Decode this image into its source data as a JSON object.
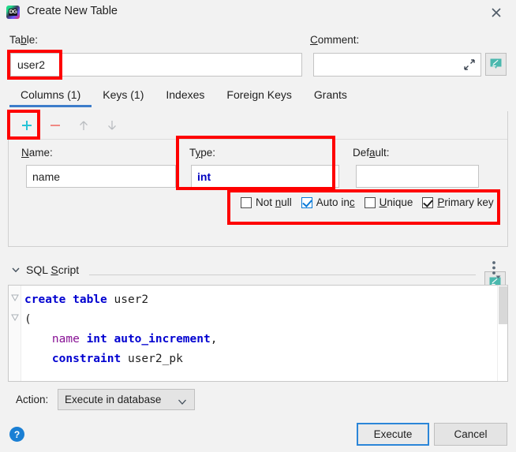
{
  "window": {
    "title": "Create New Table",
    "app_icon": "datagrip-icon",
    "close_icon": "close-icon"
  },
  "form": {
    "table_label": "Table:",
    "table_label_mnemonic": "b",
    "table_value": "user2",
    "comment_label": "Comment:",
    "comment_label_mnemonic": "C",
    "comment_value": "",
    "comment_expand_icon": "expand-icon",
    "comment_edit_icon": "edit-comment-icon"
  },
  "tabs": [
    {
      "label": "Columns (1)",
      "active": true
    },
    {
      "label": "Keys (1)",
      "active": false
    },
    {
      "label": "Indexes",
      "active": false
    },
    {
      "label": "Foreign Keys",
      "active": false
    },
    {
      "label": "Grants",
      "active": false
    }
  ],
  "toolbar": {
    "add_icon": "plus-icon",
    "remove_icon": "minus-icon",
    "move_up_icon": "arrow-up-icon",
    "move_down_icon": "arrow-down-icon"
  },
  "column_editor": {
    "name_label": "Name:",
    "name_label_mnemonic": "N",
    "name_value": "name",
    "type_label": "Type:",
    "type_label_mnemonic": "y",
    "type_value": "int",
    "default_label": "Default:",
    "default_label_mnemonic": "a",
    "default_value": "",
    "default_edit_icon": "edit-default-icon",
    "checkboxes": [
      {
        "label": "Not null",
        "mnemonic": "n",
        "checked": false,
        "accent": "default"
      },
      {
        "label": "Auto inc",
        "mnemonic": "c",
        "checked": true,
        "accent": "blue"
      },
      {
        "label": "Unique",
        "mnemonic": "U",
        "checked": false,
        "accent": "default"
      },
      {
        "label": "Primary key",
        "mnemonic": "P",
        "checked": true,
        "accent": "default"
      }
    ]
  },
  "sql_script": {
    "section_title": "SQL Script",
    "section_title_mnemonic": "S",
    "collapse_icon": "chevron-down-icon",
    "options_icon": "more-options-icon",
    "lines": [
      [
        {
          "t": "create table ",
          "c": "kw"
        },
        {
          "t": "user2",
          "c": "id"
        }
      ],
      [
        {
          "t": "(",
          "c": "id"
        }
      ],
      [
        {
          "t": "    ",
          "c": "id"
        },
        {
          "t": "name",
          "c": "col"
        },
        {
          "t": " ",
          "c": "id"
        },
        {
          "t": "int auto_increment",
          "c": "kw"
        },
        {
          "t": ",",
          "c": "id"
        }
      ],
      [
        {
          "t": "    ",
          "c": "id"
        },
        {
          "t": "constraint",
          "c": "kw"
        },
        {
          "t": " user2_pk",
          "c": "id"
        }
      ]
    ]
  },
  "action": {
    "label": "Action:",
    "selected": "Execute in database",
    "dropdown_icon": "chevron-down-icon"
  },
  "footer": {
    "help_label": "?",
    "execute_label": "Execute",
    "cancel_label": "Cancel"
  },
  "annotations": {
    "color": "#fe0000",
    "boxes": [
      "table-name-field",
      "add-column-button",
      "type-field",
      "column-flags-row"
    ]
  }
}
